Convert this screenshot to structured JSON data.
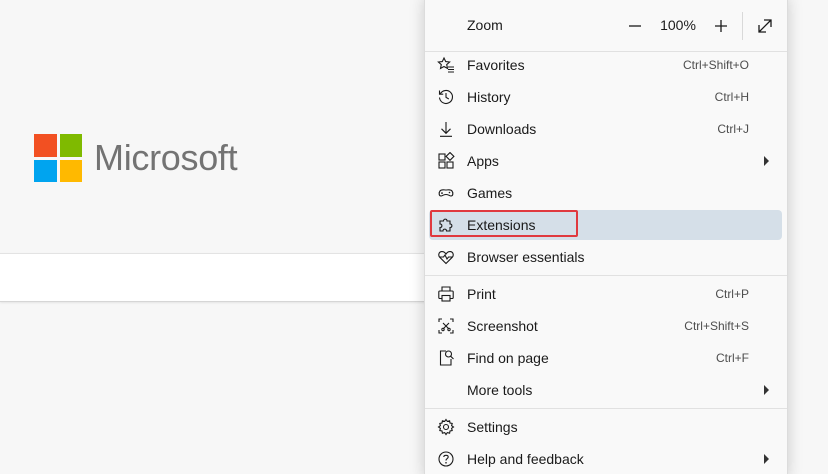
{
  "brand": {
    "name": "Microsoft",
    "logo_colors": [
      "#f25022",
      "#7fba00",
      "#00a4ef",
      "#ffb900"
    ]
  },
  "menu": {
    "zoom": {
      "label": "Zoom",
      "value": "100%"
    },
    "items": [
      {
        "label": "Favorites",
        "shortcut": "Ctrl+Shift+O",
        "icon": "star-list-icon"
      },
      {
        "label": "History",
        "shortcut": "Ctrl+H",
        "icon": "history-icon"
      },
      {
        "label": "Downloads",
        "shortcut": "Ctrl+J",
        "icon": "download-icon"
      },
      {
        "label": "Apps",
        "submenu": true,
        "icon": "apps-icon"
      },
      {
        "label": "Games",
        "icon": "games-icon"
      },
      {
        "label": "Extensions",
        "icon": "puzzle-icon",
        "active": true
      },
      {
        "label": "Browser essentials",
        "icon": "heart-pulse-icon"
      },
      {
        "label": "Print",
        "shortcut": "Ctrl+P",
        "icon": "printer-icon"
      },
      {
        "label": "Screenshot",
        "shortcut": "Ctrl+Shift+S",
        "icon": "screenshot-icon"
      },
      {
        "label": "Find on page",
        "shortcut": "Ctrl+F",
        "icon": "find-icon"
      },
      {
        "label": "More tools",
        "submenu": true
      },
      {
        "label": "Settings",
        "icon": "gear-icon"
      },
      {
        "label": "Help and feedback",
        "submenu": true,
        "icon": "help-icon"
      }
    ]
  },
  "colors": {
    "active_row": "#d5dfe8",
    "highlight_outline": "#e0393e"
  }
}
